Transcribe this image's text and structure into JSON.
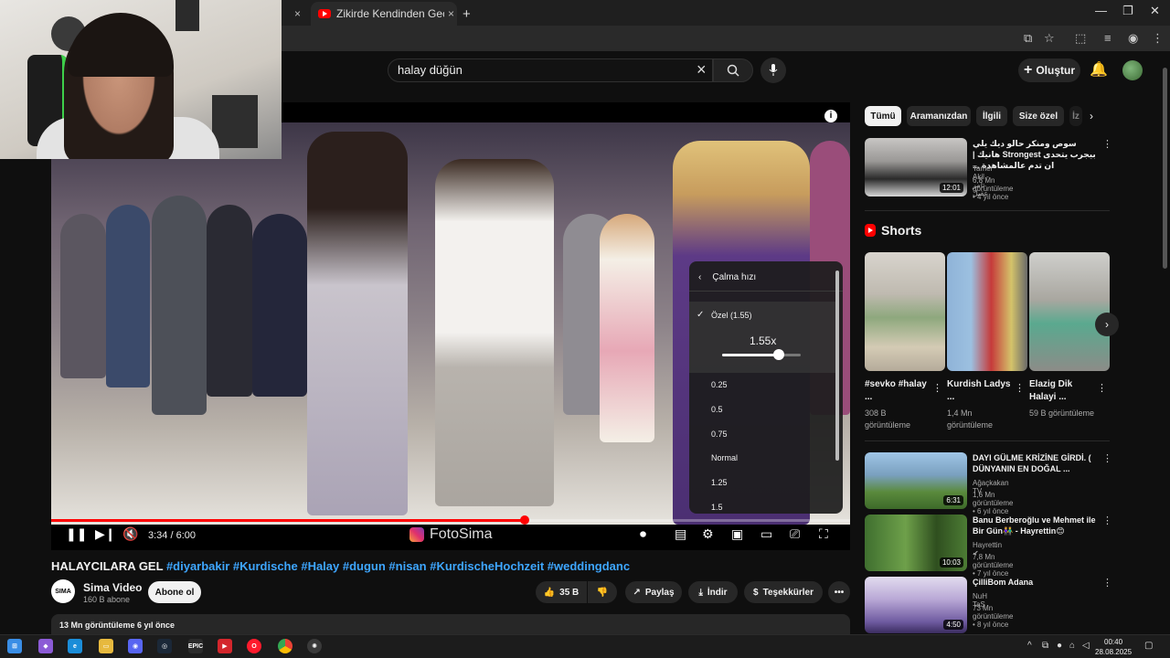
{
  "browser": {
    "tabs": [
      {
        "label": ""
      },
      {
        "label": "Zikirde Kendinden Geçen Kadı"
      }
    ],
    "new_tab": "+",
    "close_glyph": "×",
    "window_controls": [
      "—",
      "❐",
      "✕"
    ]
  },
  "header": {
    "search_value": "halay düğün",
    "create_label": "Oluştur",
    "icons": [
      "search-icon",
      "mic-icon",
      "bell-icon",
      "close-icon"
    ]
  },
  "player": {
    "time": "3:34 / 6:00",
    "progress": 0.593,
    "watermark": "FotoSima",
    "speed_menu": {
      "title": "Çalma hızı",
      "custom_label": "Özel (1.55)",
      "value": "1.55x",
      "slider_fraction": 0.72,
      "options": [
        "0.25",
        "0.5",
        "0.75",
        "Normal",
        "1.25",
        "1.5"
      ]
    }
  },
  "video": {
    "title_plain": "HALAYCILARA GEL",
    "title_tags": "#diyarbakir #Kurdische #Halay #dugun #nisan #KurdischeHochzeit #weddingdanc",
    "channel_avatar": "SIMA",
    "channel": "Sima Video",
    "subscribers": "160 B abone",
    "subscribe_label": "Abone ol",
    "likes": "35 B",
    "share_label": "Paylaş",
    "download_label": "İndir",
    "thanks_label": "Teşekkürler",
    "more_glyph": "•••",
    "description_meta": "13 Mn görüntüleme  6 yıl önce"
  },
  "sidebar": {
    "chips": [
      "Tümü",
      "Aramanızdan",
      "İlgili",
      "Size özel",
      "İz"
    ],
    "top_video": {
      "title": "سوص ومنكر حالو ديك يلي بيجرب يتحدى Strongest هانيك | ان تدم عالمشاهدة ...",
      "channel": "Tamer Akil - تامر عقيل",
      "meta": "6,8 Mn görüntüleme • 4 yıl önce",
      "duration": "12:01"
    },
    "shorts_heading": "Shorts",
    "shorts": [
      {
        "title": "#sevko #halay ...",
        "views": "308 B görüntüleme"
      },
      {
        "title": "Kurdish Ladys ...",
        "views": "1,4 Mn görüntüleme"
      },
      {
        "title": "Elazig Dik Halayi ...",
        "views": "59 B görüntüleme"
      }
    ],
    "videos": [
      {
        "title": "DAYI GÜLME KRİZİNE GİRDİ. ( DÜNYANIN EN DOĞAL ...",
        "channel": "Ağaçkakan TV",
        "meta": "1,6 Mn görüntüleme • 6 yıl önce",
        "duration": "6:31"
      },
      {
        "title": "Banu Berberoğlu ve Mehmet ile Bir Gün👫 - Hayrettin😊",
        "channel": "Hayrettin ✔",
        "meta": "7,8 Mn görüntüleme • 7 yıl önce",
        "duration": "10:03"
      },
      {
        "title": "ÇilliBom Adana",
        "channel": "NuH TaŞ",
        "meta": "73 Mn görüntüleme • 8 yıl önce",
        "duration": "4:50"
      }
    ]
  },
  "taskbar": {
    "time": "00:40",
    "date": "28.08.2025",
    "epic_label": "EPIC"
  },
  "colors": {
    "accent": "#ff0000",
    "link": "#3ea6ff",
    "background": "#0f0f0f"
  }
}
